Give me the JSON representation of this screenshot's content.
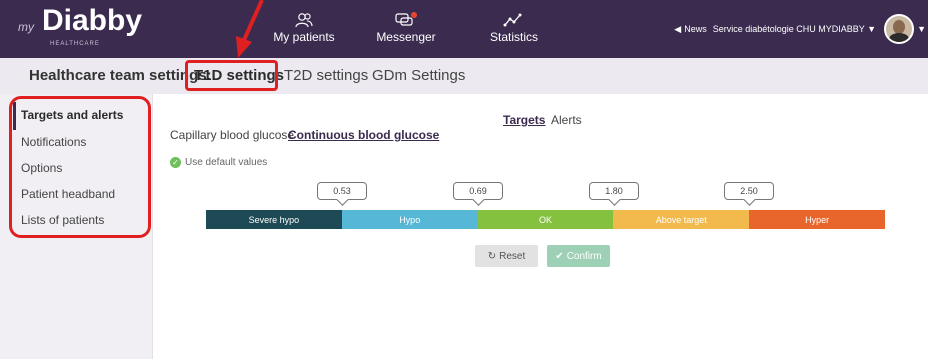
{
  "app": {
    "logo_prefix": "my",
    "logo_name": "Diabby",
    "logo_tagline": "HEALTHCARE"
  },
  "nav": {
    "items": [
      {
        "label": "My patients",
        "icon": "users-icon"
      },
      {
        "label": "Messenger",
        "icon": "chat-bubbles-icon"
      },
      {
        "label": "Statistics",
        "icon": "line-chart-icon"
      }
    ],
    "news_label": "News",
    "service_label": "Service diabétologie CHU MYDIABBY"
  },
  "settings_bar": {
    "title": "Healthcare team settings:",
    "tabs": [
      "T1D settings",
      "T2D settings",
      "GDm Settings"
    ],
    "active_tab": "T1D settings"
  },
  "sidebar": {
    "items": [
      "Targets and alerts",
      "Notifications",
      "Options",
      "Patient headband",
      "Lists of patients"
    ],
    "active": "Targets and alerts"
  },
  "main": {
    "top_tabs": [
      "Targets",
      "Alerts"
    ],
    "sub_tabs": [
      "Capillary blood glucose",
      "Continuous blood glucose"
    ],
    "default_values_label": "Use default values",
    "thresholds": [
      "0.53",
      "0.69",
      "1.80",
      "2.50"
    ],
    "segments": [
      {
        "label": "Severe hypo",
        "color": "#1e4a55"
      },
      {
        "label": "Hypo",
        "color": "#56b7d6"
      },
      {
        "label": "OK",
        "color": "#84c13f"
      },
      {
        "label": "Above target",
        "color": "#f2b94c"
      },
      {
        "label": "Hyper",
        "color": "#e8662b"
      }
    ],
    "reset_label": "Reset",
    "confirm_label": "Confirm"
  },
  "colors": {
    "topbar": "#3a2b4f",
    "annotation_red": "#e02020"
  }
}
